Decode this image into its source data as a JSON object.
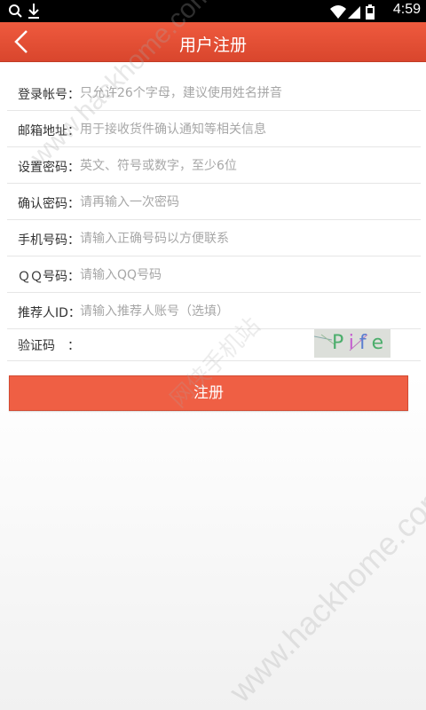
{
  "status_bar": {
    "time": "4:59",
    "left_icons": [
      "search-icon",
      "download-icon"
    ],
    "right_icons": [
      "wifi-icon",
      "signal-icon",
      "battery-icon"
    ]
  },
  "header": {
    "title": "用户注册",
    "back_icon": "chevron-left-icon",
    "color": "#e8513a"
  },
  "form": {
    "fields": [
      {
        "label": "登录帐号：",
        "placeholder": "只允许26个字母，建议使用姓名拼音"
      },
      {
        "label": "邮箱地址：",
        "placeholder": "用于接收货件确认通知等相关信息"
      },
      {
        "label": "设置密码：",
        "placeholder": "英文、符号或数字，至少6位"
      },
      {
        "label": "确认密码：",
        "placeholder": "请再输入一次密码"
      },
      {
        "label": "手机号码：",
        "placeholder": "请输入正确号码以方便联系"
      },
      {
        "label": "ＱＱ号码：",
        "placeholder": "请输入QQ号码"
      },
      {
        "label": "推荐人ID：",
        "placeholder": "请输入推荐人账号（选填）"
      }
    ],
    "captcha": {
      "label": "验证码　：",
      "placeholder": "",
      "image_text": "Pife"
    }
  },
  "actions": {
    "register_label": "注册",
    "button_color": "#ef5f44"
  },
  "watermark": {
    "text": "www.hackhome.com",
    "cn_text": "网侠手机站"
  }
}
